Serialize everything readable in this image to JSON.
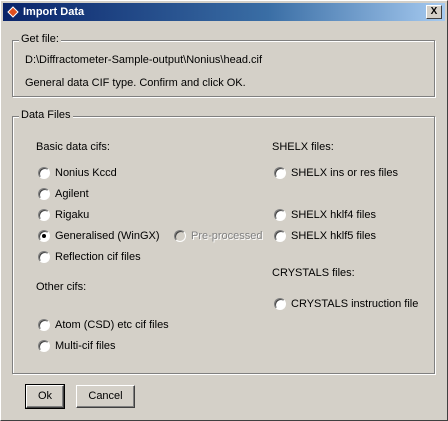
{
  "window": {
    "title": "Import Data",
    "close_label": "X"
  },
  "get_file": {
    "legend": "Get file:",
    "path": "D:\\Diffractometer-Sample-output\\Nonius\\head.cif",
    "message": "General data CIF type. Confirm and click OK."
  },
  "data_files": {
    "legend": "Data Files",
    "basic_heading": "Basic data cifs:",
    "basic_options": [
      {
        "label": "Nonius Kccd",
        "checked": false
      },
      {
        "label": "Agilent",
        "checked": false
      },
      {
        "label": "Rigaku",
        "checked": false
      },
      {
        "label": "Generalised (WinGX)",
        "checked": true
      },
      {
        "label": "Reflection cif files",
        "checked": false
      }
    ],
    "preprocessed": {
      "label": "Pre-processed",
      "checked": false,
      "disabled": true
    },
    "other_heading": "Other cifs:",
    "other_options": [
      {
        "label": "Atom (CSD) etc cif files",
        "checked": false
      },
      {
        "label": "Multi-cif files",
        "checked": false
      }
    ],
    "shelx_heading": "SHELX files:",
    "shelx_options": [
      {
        "label": "SHELX ins or res files",
        "checked": false
      },
      {
        "label": "SHELX hklf4 files",
        "checked": false
      },
      {
        "label": "SHELX hklf5 files",
        "checked": false
      }
    ],
    "crystals_heading": "CRYSTALS files:",
    "crystals_options": [
      {
        "label": "CRYSTALS instruction file",
        "checked": false
      }
    ]
  },
  "buttons": {
    "ok": "Ok",
    "cancel": "Cancel"
  }
}
